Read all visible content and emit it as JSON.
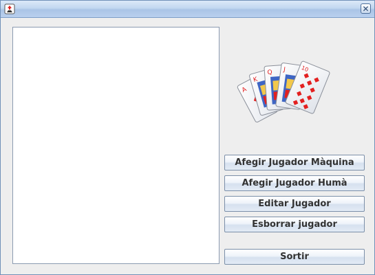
{
  "window": {
    "title": ""
  },
  "icons": {
    "app": "app-icon",
    "close": "close-icon",
    "close_glyph": "✕"
  },
  "players_list": {
    "items": []
  },
  "image": {
    "name": "royal-flush-cards"
  },
  "buttons": {
    "add_ai": "Afegir Jugador Màquina",
    "add_human": "Afegir Jugador Humà",
    "edit": "Editar Jugador",
    "delete": "Esborrar jugador",
    "exit": "Sortir"
  },
  "colors": {
    "card_red": "#e32020",
    "title_blue": "#aac4e6"
  }
}
